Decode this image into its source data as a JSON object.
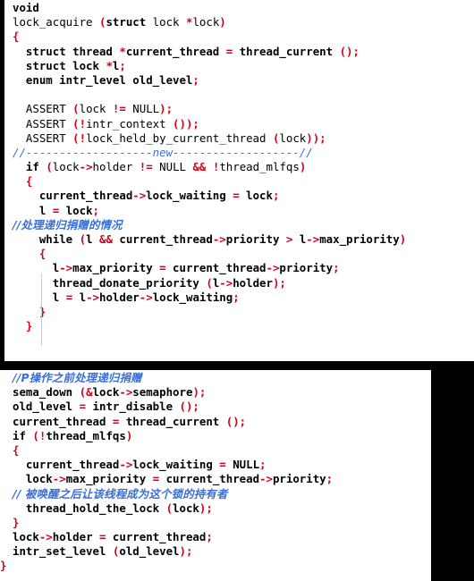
{
  "document": {
    "kind": "source-code-screenshot",
    "language": "C",
    "function": "lock_acquire",
    "colors": {
      "background": "#000000",
      "panel": "#ffffff",
      "text": "#000000",
      "punctuation": "#d0021b",
      "comment": "#3a6fd8"
    }
  },
  "panels": [
    {
      "id": "panel-top",
      "lines": [
        "void",
        "lock_acquire (struct lock *lock)",
        "{",
        "  struct thread *current_thread = thread_current ();",
        "  struct lock *l;",
        "  enum intr_level old_level;",
        "",
        "  ASSERT (lock != NULL);",
        "  ASSERT (!intr_context ());",
        "  ASSERT (!lock_held_by_current_thread (lock));",
        "  //-------------------new-------------------//",
        "  if (lock->holder != NULL && !thread_mlfqs)",
        "  {",
        "    current_thread->lock_waiting = lock;",
        "    l = lock;",
        "    //处理递归捐赠的情况",
        "    while (l && current_thread->priority > l->max_priority)",
        "    {",
        "      l->max_priority = current_thread->priority;",
        "      thread_donate_priority (l->holder);",
        "      l = l->holder->lock_waiting;",
        "    }",
        "  }"
      ]
    },
    {
      "id": "panel-bottom",
      "lines": [
        "  //P操作之前处理递归捐赠",
        "  sema_down (&lock->semaphore);",
        "  old_level = intr_disable ();",
        "  current_thread = thread_current ();",
        "  if (!thread_mlfqs)",
        "  {",
        "    current_thread->lock_waiting = NULL;",
        "    lock->max_priority = current_thread->priority;",
        "    // 被唤醒之后让该线程成为这个锁的持有者",
        "    thread_hold_the_lock (lock);",
        "  }",
        "  lock->holder = current_thread;",
        "  intr_set_level (old_level);",
        "}"
      ]
    }
  ],
  "comments": {
    "new_separator": "//-------------------new-------------------//",
    "recursive_donation": "//处理递归捐赠的情况",
    "before_p_operation": "//P操作之前处理递归捐赠",
    "hold_lock_after_wakeup": "// 被唤醒之后让该线程成为这个锁的持有者"
  }
}
